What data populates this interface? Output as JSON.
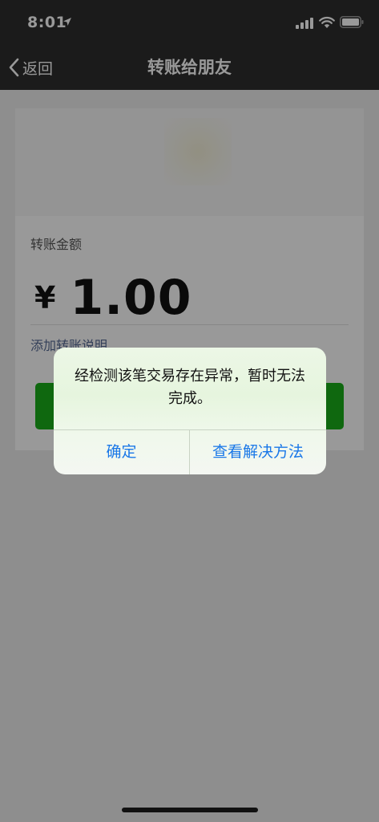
{
  "status_bar": {
    "time": "8:01"
  },
  "nav": {
    "back_label": "返回",
    "title": "转账给朋友"
  },
  "transfer": {
    "amount_label": "转账金额",
    "currency_symbol": "¥",
    "amount": "1.00",
    "add_note": "添加转账说明"
  },
  "alert": {
    "message": "经检测该笔交易存在异常，暂时无法完成。",
    "confirm_label": "确定",
    "solution_label": "查看解决方法"
  },
  "colors": {
    "nav_background": "#2e2e2e",
    "button_green": "#1aad19",
    "link_blue": "#576b95",
    "alert_button_blue": "#1a78e8"
  }
}
